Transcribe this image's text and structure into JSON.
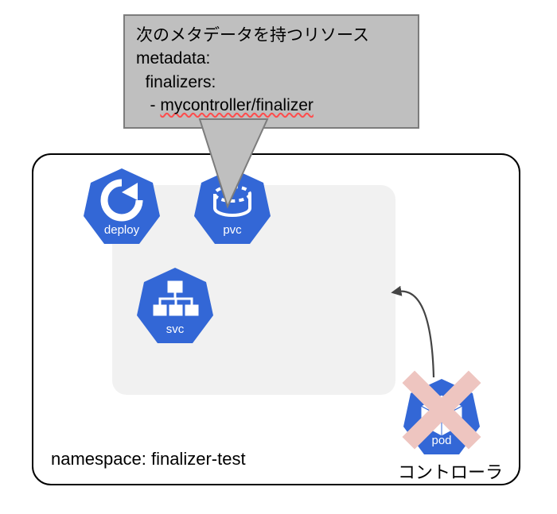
{
  "namespace_label": "namespace: finalizer-test",
  "controller_label": "コントローラ",
  "resources": {
    "deploy": "deploy",
    "pvc": "pvc",
    "svc": "svc",
    "pod": "pod"
  },
  "callout": {
    "title": "次のメタデータを持つリソース",
    "l1": "metadata:",
    "l2": "  finalizers:",
    "l3_prefix": "   - ",
    "l3_value": "mycontroller/finalizer"
  },
  "colors": {
    "k8s_blue": "#3367d6",
    "group_bg": "#f1f1f1",
    "callout_bg": "#bfbfbf",
    "callout_border": "#7c7c7c",
    "cross": "#eec5c0"
  }
}
